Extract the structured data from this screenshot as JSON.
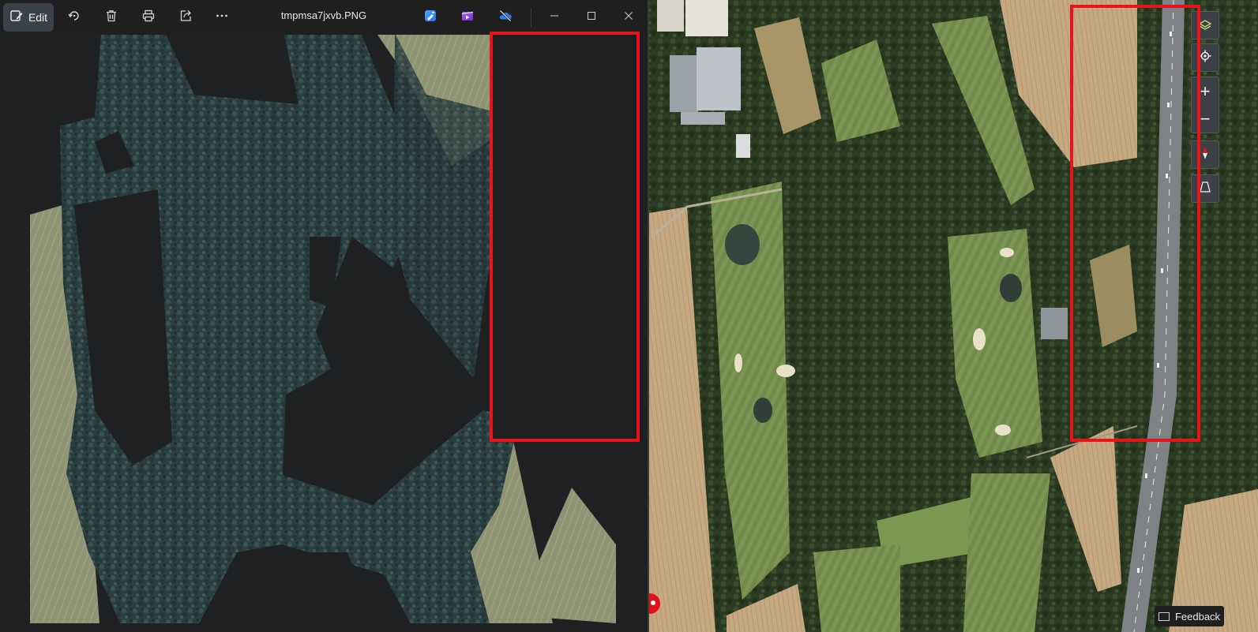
{
  "viewer": {
    "toolbar": {
      "edit_label": "Edit",
      "icons": [
        "edit-icon",
        "rotate-icon",
        "delete-icon",
        "print-icon",
        "share-icon",
        "more-icon"
      ]
    },
    "title": "tmpmsa7jxvb.PNG",
    "app_icons": [
      "image-creator-icon",
      "clipchamp-icon",
      "onedrive-offline-icon"
    ],
    "window_controls": [
      "minimize-icon",
      "maximize-icon",
      "close-icon"
    ]
  },
  "map": {
    "controls": [
      "layers-icon",
      "locate-icon",
      "zoom-in-icon",
      "zoom-out-icon",
      "compass-icon",
      "tilt-icon"
    ],
    "zoom_in_label": "+",
    "zoom_out_label": "−"
  },
  "feedback": {
    "label": "Feedback"
  },
  "colors": {
    "highlight": "#e8141a",
    "toolbar_bg": "#1f1f1f",
    "edit_active": "#3a4148"
  }
}
